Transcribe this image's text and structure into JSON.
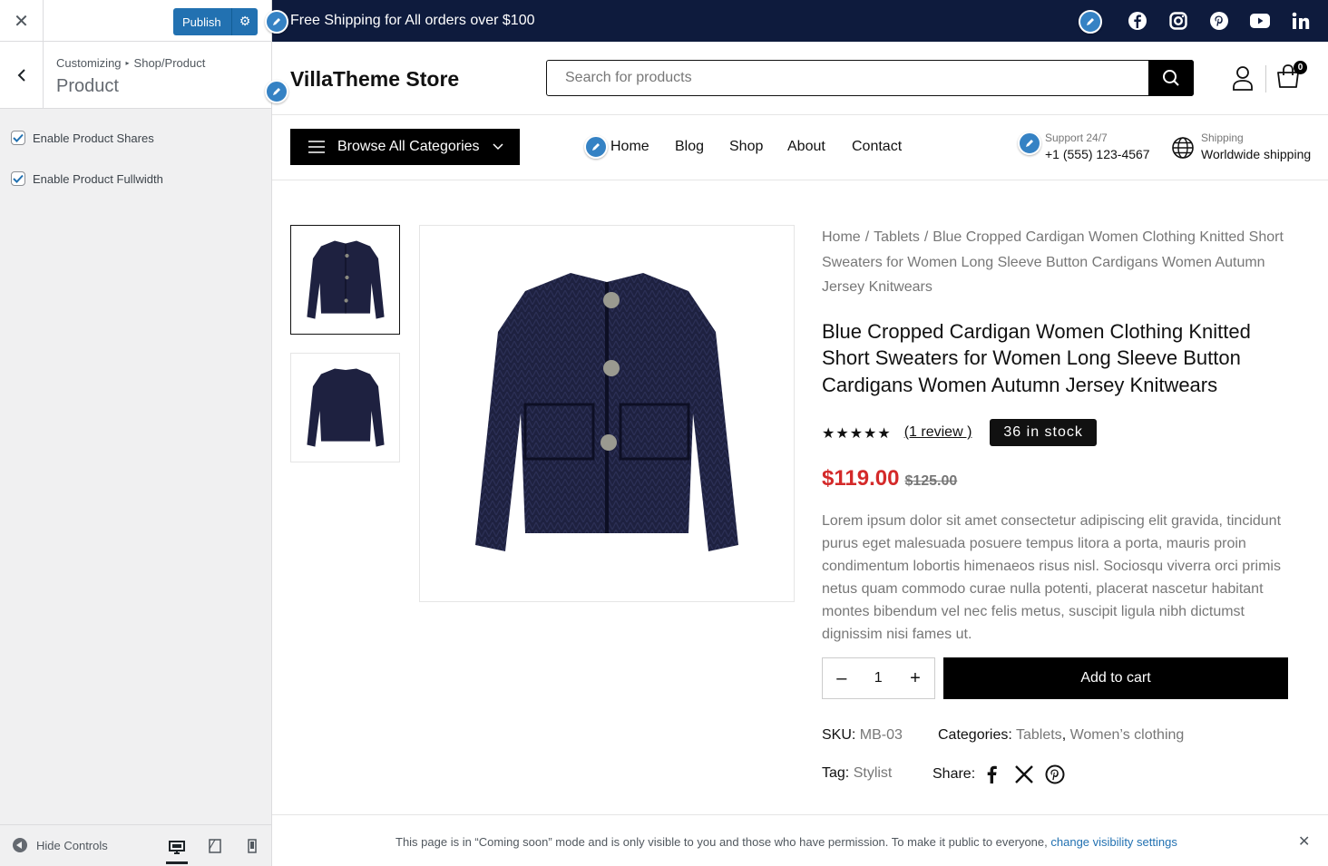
{
  "customizer": {
    "close_glyph": "✕",
    "publish_label": "Publish",
    "breadcrumb": {
      "root": "Customizing",
      "arrow": "▸",
      "section": "Shop/Product"
    },
    "section_title": "Product",
    "options": [
      {
        "label": "Enable Product Shares",
        "checked": true
      },
      {
        "label": "Enable Product Fullwidth",
        "checked": true
      }
    ],
    "hide_controls_label": "Hide Controls",
    "devices": [
      "desktop",
      "tablet",
      "mobile"
    ],
    "active_device": "desktop"
  },
  "topbar": {
    "message": "Free Shipping for All orders over $100",
    "social": [
      "facebook-icon",
      "instagram-icon",
      "pinterest-icon",
      "youtube-icon",
      "linkedin-icon"
    ]
  },
  "header": {
    "logo": "VillaTheme Store",
    "search_placeholder": "Search for products",
    "cart_count": "0"
  },
  "nav": {
    "browse_label": "Browse All Categories",
    "links": [
      "Home",
      "Blog",
      "Shop",
      "About",
      "Contact"
    ],
    "support": {
      "label": "Support 24/7",
      "value": "+1 (555) 123-4567"
    },
    "shipping": {
      "label": "Shipping",
      "value": "Worldwide shipping"
    }
  },
  "product": {
    "breadcrumb": [
      "Home",
      "Tablets",
      "Blue Cropped Cardigan Women Clothing Knitted Short Sweaters for Women Long Sleeve Button Cardigans Women Autumn Jersey Knitwears"
    ],
    "breadcrumb_sep": "/",
    "title": "Blue Cropped Cardigan Women Clothing Knitted Short Sweaters for Women Long Sleeve Button Cardigans Women Autumn Jersey Knitwears",
    "stars": "★★★★★",
    "rating": 5,
    "reviews": "(1 review )",
    "stock": "36 in stock",
    "price": "$119.00",
    "old_price": "$125.00",
    "description": "Lorem ipsum dolor sit amet consectetur adipiscing elit gravida, tincidunt purus eget malesuada posuere tempus litora a porta, mauris proin condimentum lobortis himenaeos risus nisl. Sociosqu viverra orci primis netus quam commodo curae nulla potenti, placerat nascetur habitant montes bibendum vel nec felis metus, suscipit ligula nibh dictumst dignissim nisi fames ut.",
    "quantity": "1",
    "qty_minus": "–",
    "qty_plus": "+",
    "add_to_cart": "Add to cart",
    "sku_label": "SKU:",
    "sku": "MB-03",
    "categories_label": "Categories:",
    "categories": [
      "Tablets",
      "Women’s clothing"
    ],
    "categories_sep": ",",
    "tag_label": "Tag:",
    "tag": "Stylist",
    "share_label": "Share:",
    "colors": {
      "jacket": "#1e2140",
      "price": "#d42a2a"
    }
  },
  "notice": {
    "text": "This page is in “Coming soon” mode and is only visible to you and those who have permission. To make it public to everyone,",
    "link": "change visibility settings",
    "close_glyph": "✕"
  },
  "colors": {
    "topbar": "#0e1b3d",
    "accent": "#2271b1",
    "pencil": "#3582c4"
  }
}
